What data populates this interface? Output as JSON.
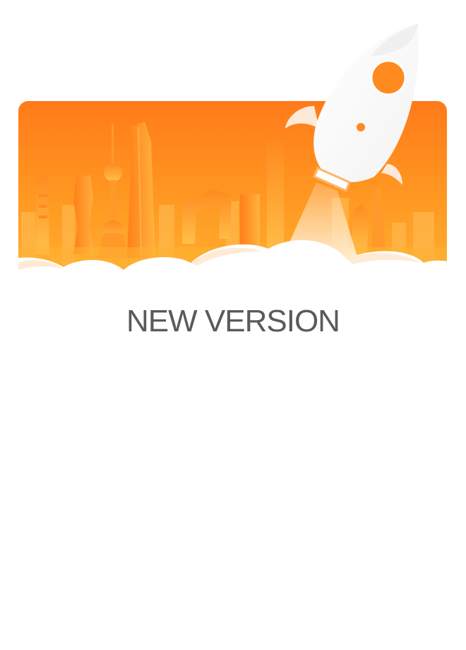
{
  "dialog": {
    "title": "NEW VERSION"
  },
  "illustration": {
    "icon": "rocket-city-skyline-illustration",
    "colors": {
      "sky_top": "#ff7a1a",
      "sky_bottom": "#ffb233",
      "building_light": "#ffb84d",
      "building_dark": "#ff8a1f",
      "rocket_body": "#ffffff",
      "rocket_window": "#ff8a1f",
      "cloud": "#ffffff"
    }
  }
}
